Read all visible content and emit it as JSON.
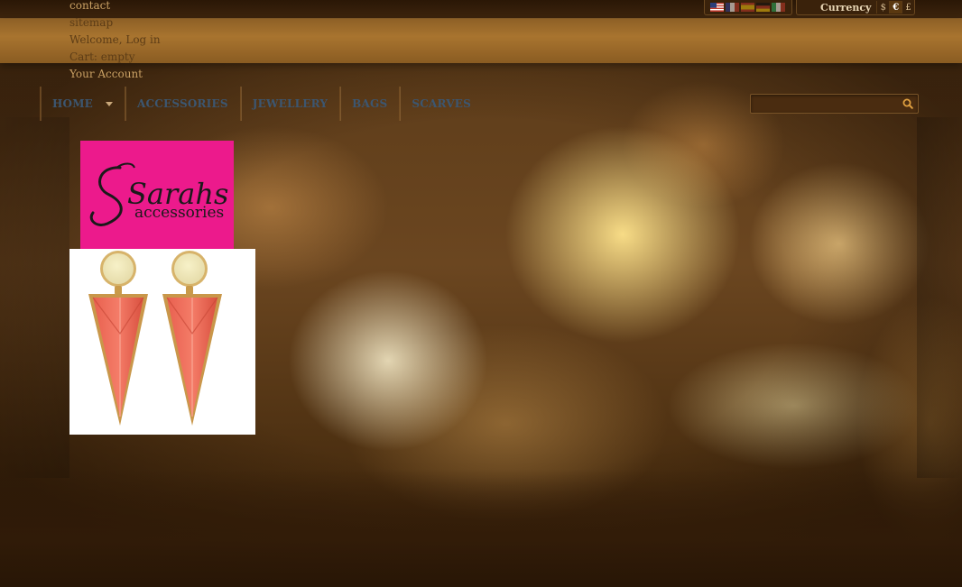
{
  "header": {
    "links": [
      {
        "label": "contact",
        "dim": false
      },
      {
        "label": "sitemap",
        "dim": true
      },
      {
        "label": "Welcome, Log in",
        "dim": true
      },
      {
        "label": "Cart: empty",
        "dim": true
      },
      {
        "label": "Your Account",
        "dim": false
      }
    ],
    "languages": [
      "us-flag-icon",
      "fr-flag-icon",
      "es-flag-icon",
      "de-flag-icon",
      "it-flag-icon"
    ],
    "currency": {
      "label": "Currency",
      "options": [
        "$",
        "€",
        "£"
      ],
      "selected": "€"
    }
  },
  "nav": {
    "items": [
      {
        "label": "HOME",
        "has_dropdown": true
      },
      {
        "label": "ACCESSORIES",
        "has_dropdown": false
      },
      {
        "label": "JEWELLERY",
        "has_dropdown": false
      },
      {
        "label": "BAGS",
        "has_dropdown": false
      },
      {
        "label": "SCARVES",
        "has_dropdown": false
      }
    ]
  },
  "search": {
    "value": "",
    "placeholder": "",
    "icon": "search-icon"
  },
  "logo": {
    "script_text": "Sarahs",
    "sub_text": "accessories",
    "background": "#ec1a8c"
  },
  "product": {
    "image": "earrings-image"
  },
  "colors": {
    "nav_text": "#3c5670",
    "link_text": "#c9a063",
    "header_band": "#a8742f"
  }
}
